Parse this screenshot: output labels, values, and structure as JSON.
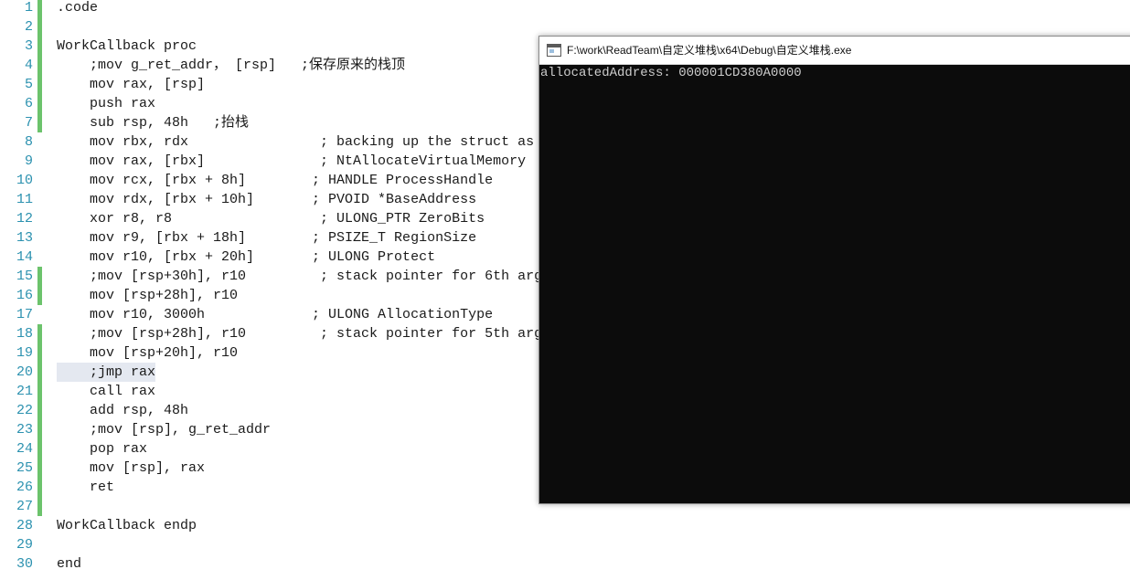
{
  "editor": {
    "lines": [
      {
        "num": "1",
        "text": ".code",
        "changed": true
      },
      {
        "num": "2",
        "text": "",
        "changed": true
      },
      {
        "num": "3",
        "text": "WorkCallback proc",
        "changed": true
      },
      {
        "num": "4",
        "text": "    ;mov g_ret_addr， [rsp]   ;保存原来的栈顶",
        "changed": true
      },
      {
        "num": "5",
        "text": "    mov rax, [rsp]",
        "changed": true
      },
      {
        "num": "6",
        "text": "    push rax",
        "changed": true
      },
      {
        "num": "7",
        "text": "    sub rsp, 48h   ;抬栈",
        "changed": true
      },
      {
        "num": "8",
        "text": "    mov rbx, rdx                ; backing up the struct as we",
        "changed": false
      },
      {
        "num": "9",
        "text": "    mov rax, [rbx]              ; NtAllocateVirtualMemory",
        "changed": false
      },
      {
        "num": "10",
        "text": "    mov rcx, [rbx + 8h]        ; HANDLE ProcessHandle",
        "changed": false
      },
      {
        "num": "11",
        "text": "    mov rdx, [rbx + 10h]       ; PVOID *BaseAddress",
        "changed": false
      },
      {
        "num": "12",
        "text": "    xor r8, r8                  ; ULONG_PTR ZeroBits",
        "changed": false
      },
      {
        "num": "13",
        "text": "    mov r9, [rbx + 18h]        ; PSIZE_T RegionSize",
        "changed": false
      },
      {
        "num": "14",
        "text": "    mov r10, [rbx + 20h]       ; ULONG Protect",
        "changed": false
      },
      {
        "num": "15",
        "text": "    ;mov [rsp+30h], r10         ; stack pointer for 6th arg",
        "changed": true
      },
      {
        "num": "16",
        "text": "    mov [rsp+28h], r10",
        "changed": true
      },
      {
        "num": "17",
        "text": "    mov r10, 3000h             ; ULONG AllocationType",
        "changed": false
      },
      {
        "num": "18",
        "text": "    ;mov [rsp+28h], r10         ; stack pointer for 5th arg",
        "changed": true
      },
      {
        "num": "19",
        "text": "    mov [rsp+20h], r10",
        "changed": true
      },
      {
        "num": "20",
        "text": "    ;jmp rax",
        "changed": true,
        "highlight": true
      },
      {
        "num": "21",
        "text": "    call rax",
        "changed": true
      },
      {
        "num": "22",
        "text": "    add rsp, 48h",
        "changed": true
      },
      {
        "num": "23",
        "text": "    ;mov [rsp], g_ret_addr",
        "changed": true
      },
      {
        "num": "24",
        "text": "    pop rax",
        "changed": true
      },
      {
        "num": "25",
        "text": "    mov [rsp], rax",
        "changed": true
      },
      {
        "num": "26",
        "text": "    ret",
        "changed": true
      },
      {
        "num": "27",
        "text": "",
        "changed": true
      },
      {
        "num": "28",
        "text": "WorkCallback endp",
        "changed": false
      },
      {
        "num": "29",
        "text": "",
        "changed": false
      },
      {
        "num": "30",
        "text": "end",
        "changed": false
      }
    ]
  },
  "console": {
    "title": "F:\\work\\ReadTeam\\自定义堆栈\\x64\\Debug\\自定义堆栈.exe",
    "output": "allocatedAddress: 000001CD380A0000"
  },
  "colors": {
    "line_number": "#2b91af",
    "change_marker": "#6cc36c",
    "console_bg": "#0c0c0c",
    "console_text": "#cccccc"
  }
}
